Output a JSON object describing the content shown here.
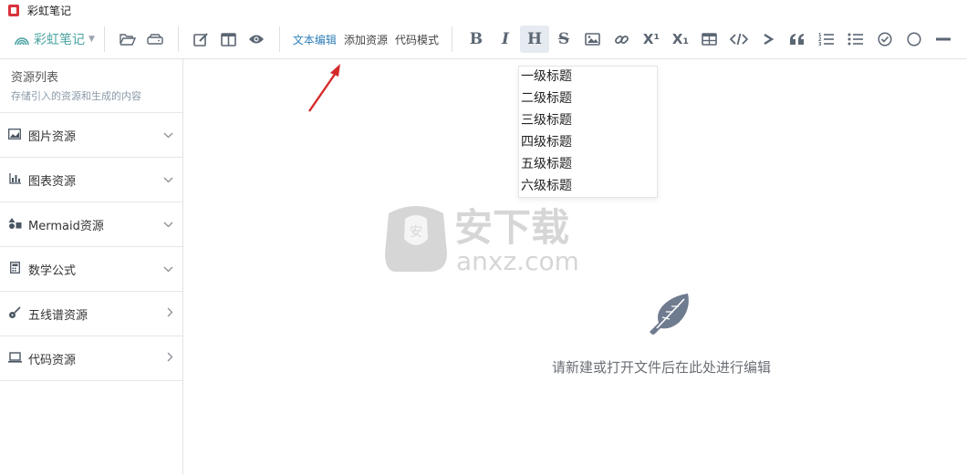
{
  "window": {
    "title": "彩虹笔记"
  },
  "toolbar": {
    "brand_label": "彩虹笔记",
    "mode_tabs": [
      "文本编辑",
      "添加资源",
      "代码模式"
    ],
    "active_mode": "文本编辑",
    "format_buttons": [
      "bold",
      "italic",
      "heading",
      "strikethrough",
      "image",
      "link",
      "superscript",
      "subscript",
      "table",
      "code",
      "quote-arrow",
      "blockquote",
      "ordered-list",
      "unordered-list",
      "task",
      "circle",
      "horizontal-rule"
    ],
    "superscript_glyph": "X¹",
    "subscript_glyph": "X₁"
  },
  "sidebar": {
    "title": "资源列表",
    "subtitle": "存储引入的资源和生成的内容",
    "items": [
      {
        "label": "图片资源",
        "icon": "image-icon",
        "expanded": true
      },
      {
        "label": "图表资源",
        "icon": "bar-chart-icon",
        "expanded": true
      },
      {
        "label": "Mermaid资源",
        "icon": "shapes-icon",
        "expanded": true
      },
      {
        "label": "数学公式",
        "icon": "calculator-icon",
        "expanded": true
      },
      {
        "label": "五线谱资源",
        "icon": "guitar-icon",
        "expanded": false
      },
      {
        "label": "代码资源",
        "icon": "laptop-icon",
        "expanded": false
      }
    ]
  },
  "heading_menu": {
    "items": [
      "一级标题",
      "二级标题",
      "三级标题",
      "四级标题",
      "五级标题",
      "六级标题"
    ]
  },
  "main": {
    "empty_message": "请新建或打开文件后在此处进行编辑"
  },
  "watermark": {
    "text_cn": "安下载",
    "text_en": "anxz.com"
  },
  "colors": {
    "brand": "#4aa3a2",
    "active_tab": "#2f7fb8",
    "icon": "#5b6673",
    "feather": "#6f7b8f"
  }
}
